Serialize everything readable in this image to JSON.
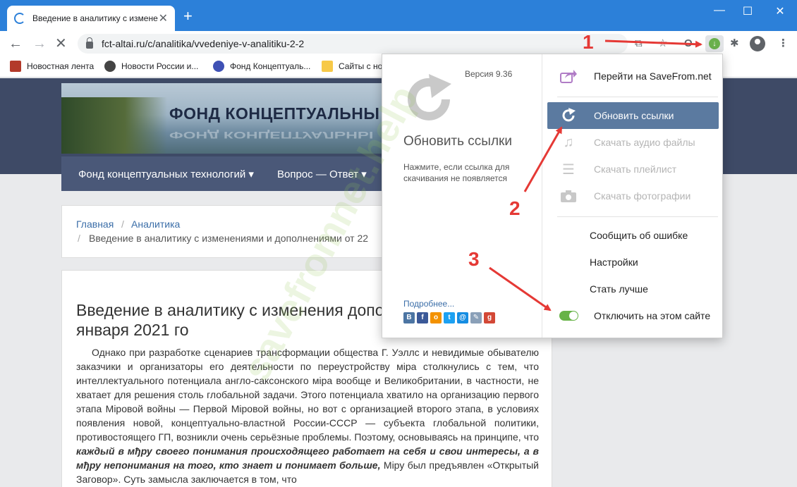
{
  "browser": {
    "tab_title": "Введение в аналитику с измене",
    "url": "fct-altai.ru/c/analitika/vvedeniye-v-analitiku-2-2",
    "bookmarks": [
      "Новостная лента",
      "Новости России и...",
      "Фонд Концептуаль...",
      "Сайты с но"
    ]
  },
  "site": {
    "banner_title": "ФОНД КОНЦЕПТУАЛЬНЫ",
    "nav": [
      "Фонд концептуальных технологий ▾",
      "Вопрос — Ответ ▾"
    ],
    "breadcrumb": {
      "home": "Главная",
      "section": "Аналитика",
      "current": "Введение в аналитику с изменениями и дополнениями от 22"
    },
    "article": {
      "title": "Введение в аналитику с изменения дополнениями от 22 января 2021 го",
      "body_1": "Однако при разработке сценариев трансформации общества Г. Уэллс и невидимые обывателю заказчики и организаторы его деятельности по переустройству міра столкнулись с тем, что интеллектуального потенциала англо-саксонского міра вообще и Великобритании, в частности, не хватает для решения столь глобальной задачи. Этого потенциала хватило на организацию первого этапа Міровой войны — Первой Міровой войны, но вот с организацией второго этапа, в условиях появления новой, концептуально-властной России-СССР — субъекта глобальной политики, противостоящего ГП, возникли очень серьёзные проблемы. Поэтому, основываясь на принципе, что ",
      "body_bold": "каждый в мђру своего понимания происходящего работает на себя и свои интересы, а в мђру непонимания на того, кто знает и понимает больше,",
      "body_2": " Міру был предъявлен «Открытый Заговор». Суть замысла заключается в том, что"
    }
  },
  "popup": {
    "version": "Версия 9.36",
    "title": "Обновить ссылки",
    "hint": "Нажмите, если ссылка для скачивания не появляется",
    "more": "Подробнее...",
    "menu": {
      "goto": "Перейти на SaveFrom.net",
      "refresh": "Обновить ссылки",
      "audio": "Скачать аудио файлы",
      "playlist": "Скачать плейлист",
      "photos": "Скачать фотографии",
      "report": "Сообщить об ошибке",
      "settings": "Настройки",
      "improve": "Стать лучше",
      "disable": "Отключить на этом сайте"
    },
    "toggle_on": true
  },
  "annotations": [
    "1",
    "2",
    "3"
  ],
  "watermark": "savefromnet.help",
  "colors": {
    "titlebar": "#2c80d9",
    "menu_active": "#5b7aa0",
    "toggle": "#67b347",
    "annotation": "#e53935"
  }
}
